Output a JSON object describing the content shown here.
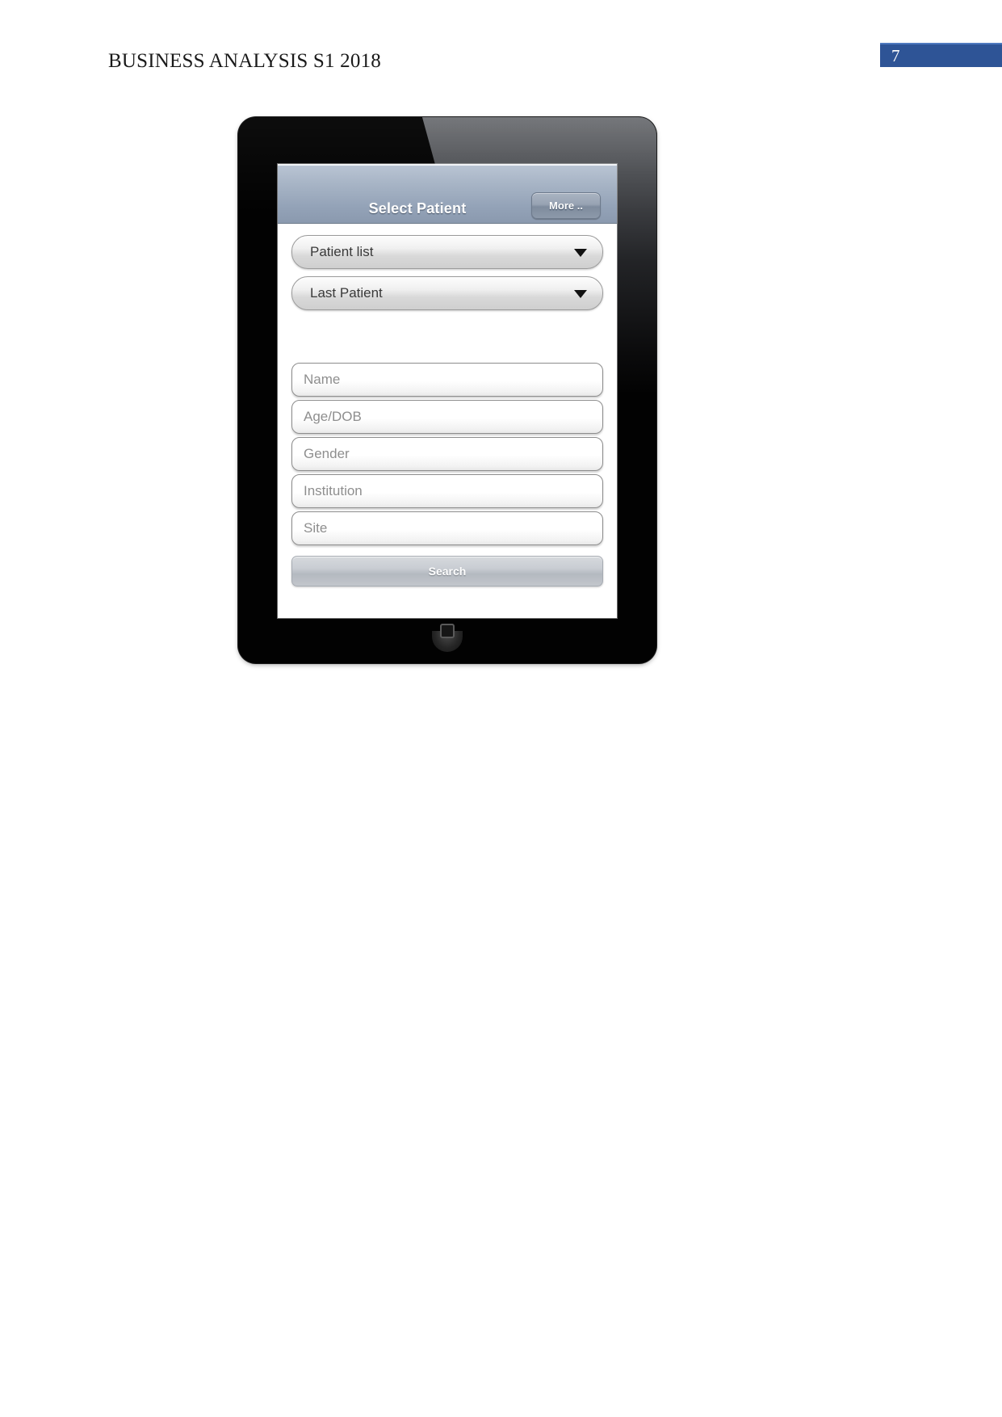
{
  "document": {
    "header_title": "BUSINESS ANALYSIS S1 2018",
    "page_number": "7",
    "accent_color": "#2e5496"
  },
  "device": {
    "name": "tablet-mockup",
    "home_button_label": "Home"
  },
  "app": {
    "titlebar": {
      "title": "Select Patient",
      "more_button_label": "More .."
    },
    "dropdowns": [
      {
        "name": "patient-list",
        "value": "Patient list"
      },
      {
        "name": "last-patient",
        "value": "Last Patient"
      }
    ],
    "fields": [
      {
        "name": "name",
        "placeholder": "Name",
        "value": ""
      },
      {
        "name": "age-dob",
        "placeholder": "Age/DOB",
        "value": ""
      },
      {
        "name": "gender",
        "placeholder": "Gender",
        "value": ""
      },
      {
        "name": "institution",
        "placeholder": "Institution",
        "value": ""
      },
      {
        "name": "site",
        "placeholder": "Site",
        "value": ""
      }
    ],
    "search_button_label": "Search"
  }
}
